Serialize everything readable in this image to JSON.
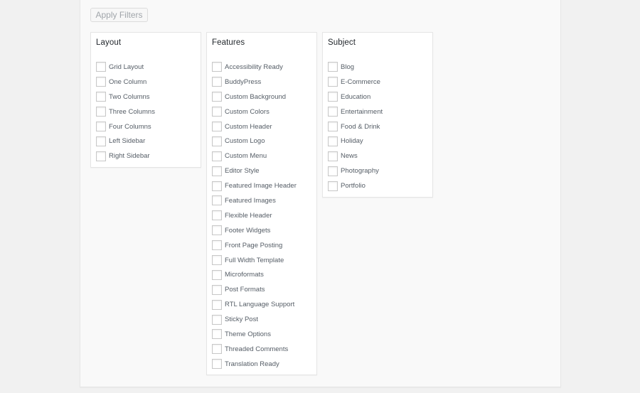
{
  "apply_filters_label": "Apply Filters",
  "groups": {
    "layout": {
      "title": "Layout",
      "items": [
        "Grid Layout",
        "One Column",
        "Two Columns",
        "Three Columns",
        "Four Columns",
        "Left Sidebar",
        "Right Sidebar"
      ]
    },
    "features": {
      "title": "Features",
      "items": [
        "Accessibility Ready",
        "BuddyPress",
        "Custom Background",
        "Custom Colors",
        "Custom Header",
        "Custom Logo",
        "Custom Menu",
        "Editor Style",
        "Featured Image Header",
        "Featured Images",
        "Flexible Header",
        "Footer Widgets",
        "Front Page Posting",
        "Full Width Template",
        "Microformats",
        "Post Formats",
        "RTL Language Support",
        "Sticky Post",
        "Theme Options",
        "Threaded Comments",
        "Translation Ready"
      ]
    },
    "subject": {
      "title": "Subject",
      "items": [
        "Blog",
        "E-Commerce",
        "Education",
        "Entertainment",
        "Food & Drink",
        "Holiday",
        "News",
        "Photography",
        "Portfolio"
      ]
    }
  },
  "checked": []
}
